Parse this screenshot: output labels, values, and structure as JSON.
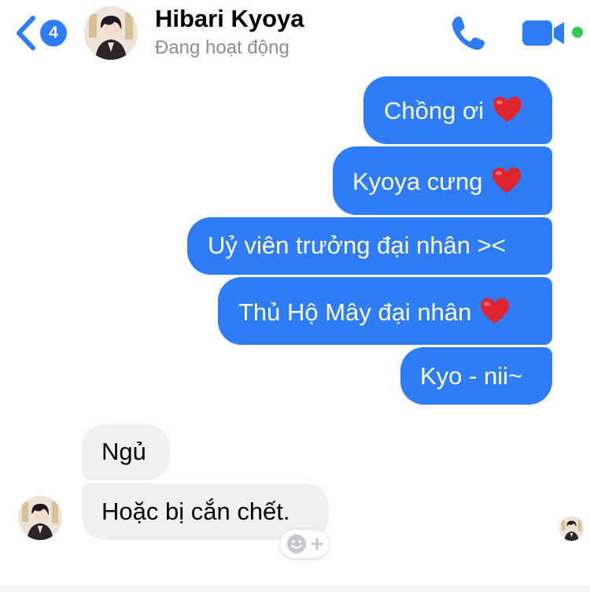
{
  "header": {
    "back_badge_count": "4",
    "contact_name": "Hibari Kyoya",
    "status": "Đang hoạt động",
    "icons": {
      "back": "chevron-left-icon",
      "call": "phone-icon",
      "video": "video-camera-icon",
      "online": "online-dot-icon"
    }
  },
  "messages": [
    {
      "sender": "me",
      "text": "Chồng ơi",
      "emoji": "heart-icon"
    },
    {
      "sender": "me",
      "text": "Kyoya cưng",
      "emoji": "heart-icon"
    },
    {
      "sender": "me",
      "text": "Uỷ viên trưởng đại nhân ><"
    },
    {
      "sender": "me",
      "text": "Thủ Hộ Mây đại nhân",
      "emoji": "heart-icon"
    },
    {
      "sender": "me",
      "text": "Kyo - nii~"
    },
    {
      "sender": "them",
      "text": "Ngủ"
    },
    {
      "sender": "them",
      "text": "Hoặc bị cắn chết."
    }
  ],
  "reaction_button_icon": "add-reaction-icon",
  "colors": {
    "accent": "#2e7cf6",
    "incoming_bubble": "#f0f0f0",
    "heart": "#e0242d",
    "online": "#35c759",
    "status_text": "#8e8e93"
  }
}
